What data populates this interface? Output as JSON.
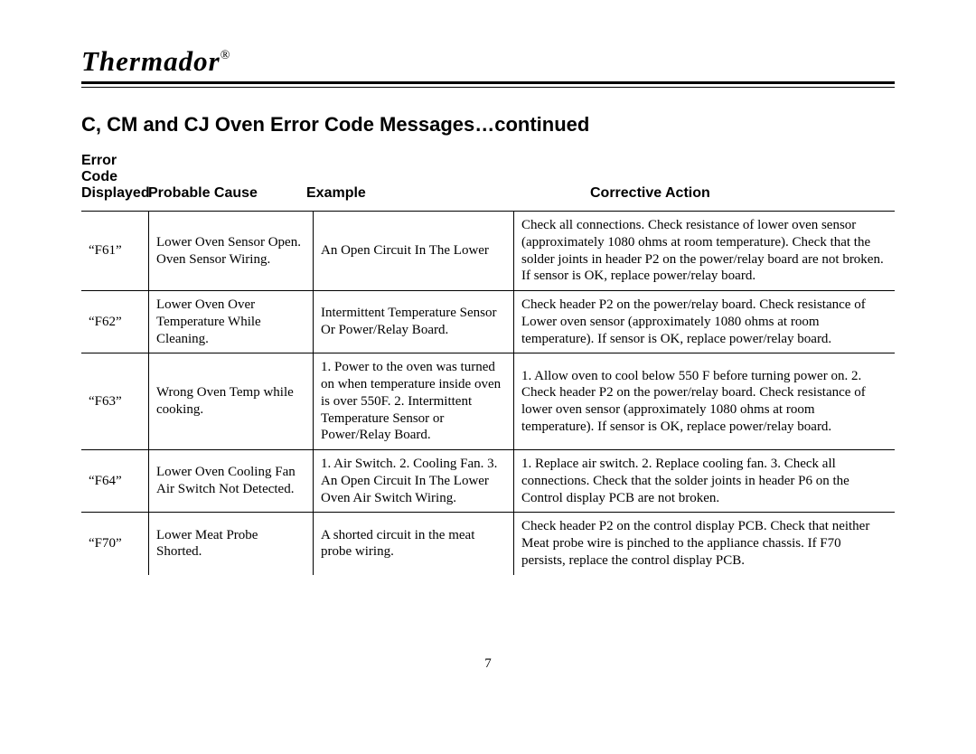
{
  "brand": "Thermador",
  "reg": "®",
  "section_title": "C, CM and CJ Oven Error Code Messages…continued",
  "headers": {
    "top": "Error Code",
    "c1": "Displayed",
    "c2": "Probable Cause",
    "c3": "Example",
    "c4": "Corrective Action"
  },
  "rows": [
    {
      "code": "“F61”",
      "cause": "Lower Oven Sensor Open. Oven Sensor Wiring.",
      "example": "An Open Circuit In The Lower",
      "action": "Check all connections. Check resistance of lower oven sensor (approximately 1080 ohms at room temperature). Check that the solder joints in header P2 on the power/relay board are not broken. If sensor is OK, replace power/relay board."
    },
    {
      "code": "“F62”",
      "cause": "Lower Oven Over Temperature While Cleaning.",
      "example": "Intermittent Temperature Sensor Or Power/Relay Board.",
      "action": "Check header P2 on the power/relay board. Check resistance of Lower oven sensor (approximately 1080 ohms at room temperature). If sensor is OK, replace power/relay board."
    },
    {
      "code": "“F63”",
      "cause": "Wrong Oven Temp while cooking.",
      "example": "1. Power to the oven was turned on when temperature inside oven is over 550F. 2. Intermittent Temperature Sensor or Power/Relay Board.",
      "action": "1. Allow oven to cool below 550 F before turning power on. 2. Check header P2 on the power/relay board. Check resistance of lower oven sensor (approximately 1080 ohms at room temperature). If sensor is OK, replace power/relay board."
    },
    {
      "code": "“F64”",
      "cause": "Lower Oven Cooling Fan Air Switch Not Detected.",
      "example": "1. Air Switch. 2. Cooling Fan. 3. An Open Circuit In The Lower Oven Air Switch Wiring.",
      "action": "1. Replace air switch. 2. Replace cooling fan. 3. Check all connections. Check that the solder joints in header P6 on the Control display PCB are not broken."
    },
    {
      "code": "“F70”",
      "cause": "Lower Meat Probe Shorted.",
      "example": "A shorted circuit in the meat probe wiring.",
      "action": "Check header P2 on the control display PCB. Check that neither Meat probe wire is pinched to the appliance chassis. If F70 persists, replace the control display PCB."
    }
  ],
  "page_number": "7"
}
